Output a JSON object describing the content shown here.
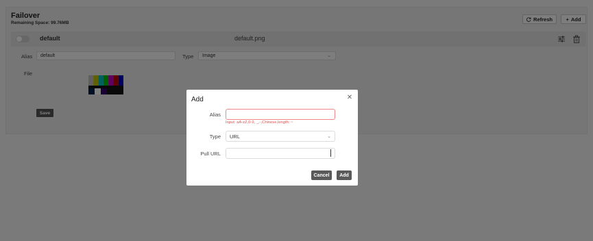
{
  "page": {
    "title": "Failover",
    "remaining_space": "Remaining Space: 99.76MB",
    "refresh_label": "Refresh",
    "add_label": "Add",
    "refresh_icon": "refresh-icon",
    "add_icon": "plus-icon"
  },
  "item": {
    "enabled": false,
    "name": "default",
    "file_name": "default.png",
    "alias_label": "Alias",
    "alias_value": "default",
    "type_label": "Type",
    "type_value": "Image",
    "file_label": "File",
    "save_label": "Save",
    "settings_icon": "sliders-icon",
    "delete_icon": "trash-icon"
  },
  "modal": {
    "title": "Add",
    "alias_label": "Alias",
    "alias_value": "",
    "alias_hint": "Input: aA-zZ,0-9, _,-,Chinese,length: ~",
    "type_label": "Type",
    "type_value": "URL",
    "pull_url_label": "Pull URL",
    "pull_url_value": "",
    "cancel_label": "Cancel",
    "add_label": "Add",
    "close_icon": "close-icon"
  },
  "colors": {
    "error": "#e05050",
    "button_dark": "#5a5a5a",
    "overlay": "rgba(0,0,0,0.5)"
  }
}
